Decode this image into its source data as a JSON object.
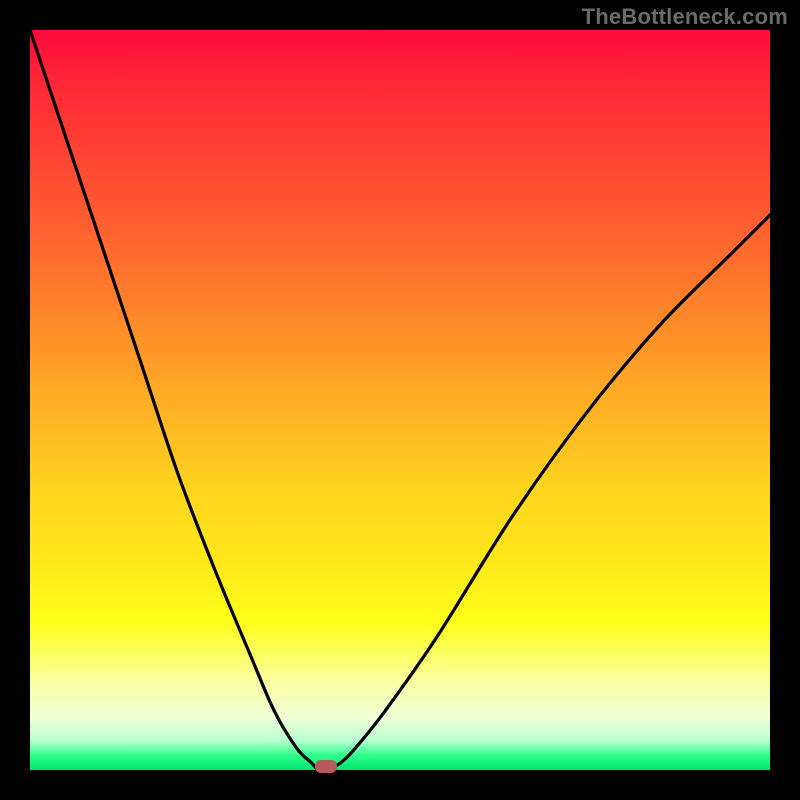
{
  "watermark": "TheBottleneck.com",
  "colors": {
    "frame": "#000000",
    "gradient_top": "#ff0a3a",
    "gradient_mid": "#ffd41e",
    "gradient_bottom": "#00e66c",
    "curve": "#000000",
    "marker": "#b45a5a"
  },
  "chart_data": {
    "type": "line",
    "title": "",
    "xlabel": "",
    "ylabel": "",
    "xlim": [
      0,
      100
    ],
    "ylim": [
      0,
      100
    ],
    "series": [
      {
        "name": "bottleneck-curve",
        "x": [
          0,
          5,
          10,
          15,
          20,
          25,
          30,
          33,
          36,
          38,
          39,
          40,
          42,
          44,
          48,
          55,
          65,
          75,
          85,
          95,
          100
        ],
        "y": [
          100,
          85,
          70,
          55,
          40,
          27,
          15,
          8,
          3,
          1,
          0,
          0,
          1,
          3,
          8,
          18,
          34,
          48,
          60,
          70,
          75
        ]
      }
    ],
    "marker": {
      "x": 40,
      "y": 0
    },
    "annotations": []
  }
}
